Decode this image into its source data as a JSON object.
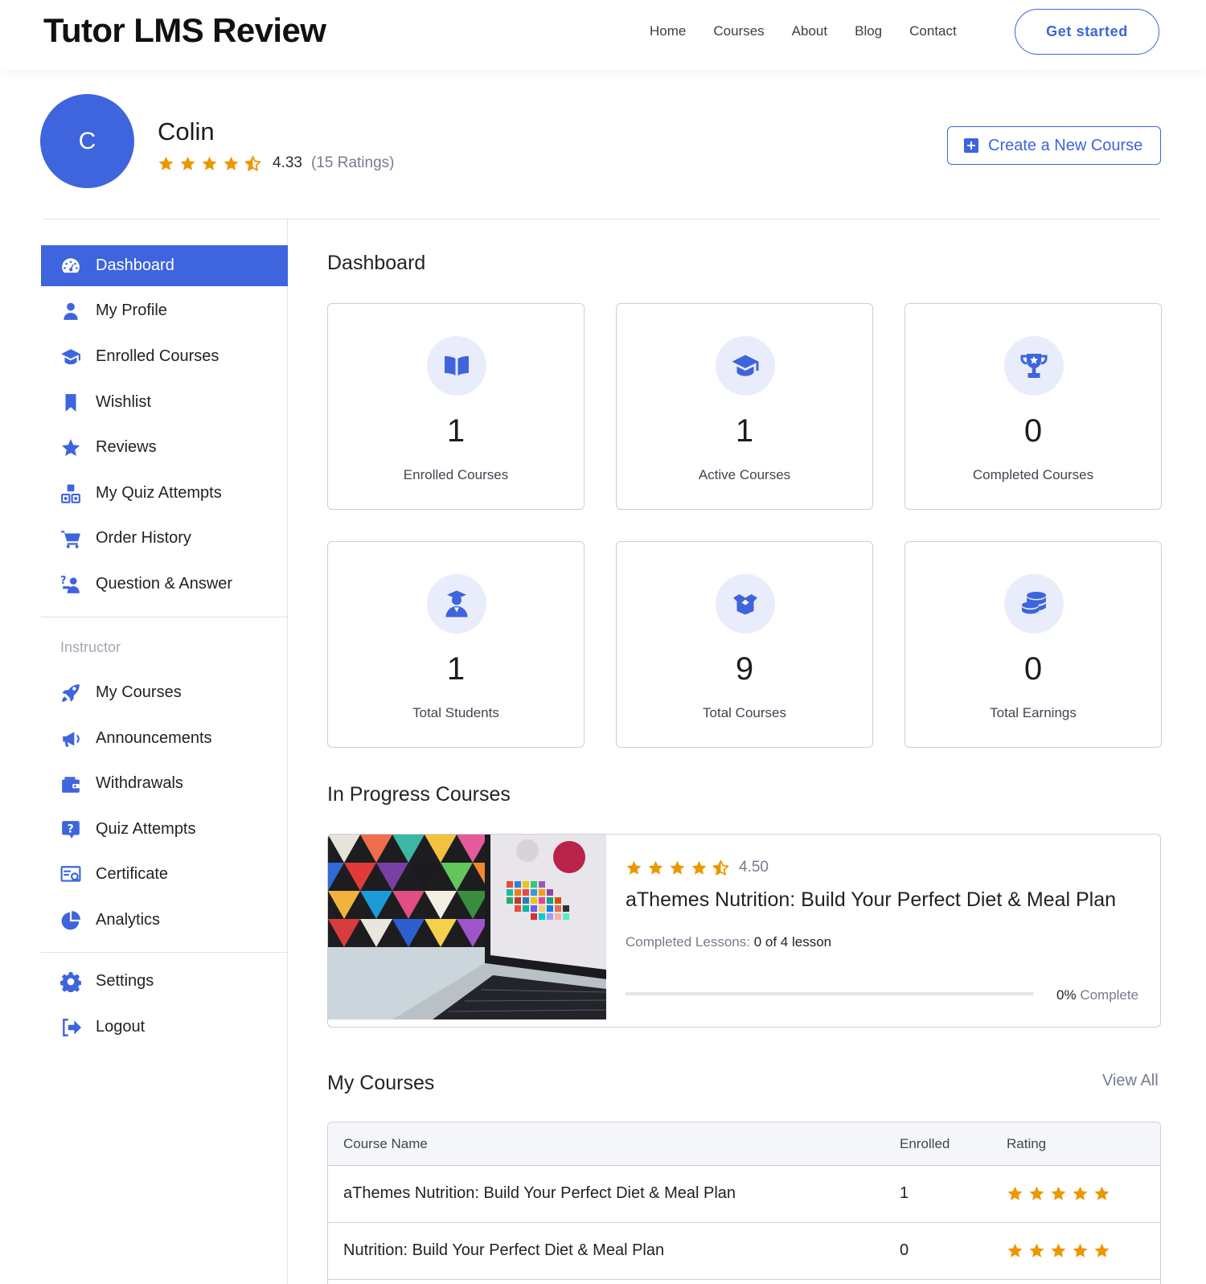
{
  "header": {
    "site_title": "Tutor LMS Review",
    "nav": [
      "Home",
      "Courses",
      "About",
      "Blog",
      "Contact"
    ],
    "cta": "Get started"
  },
  "profile": {
    "avatar_letter": "C",
    "name": "Colin",
    "rating": "4.33",
    "rating_count": "(15 Ratings)",
    "rating_stars": 4.33,
    "create_button": "Create a New Course"
  },
  "sidebar": {
    "items": [
      {
        "label": "Dashboard",
        "icon": "dashboard-icon",
        "active": true
      },
      {
        "label": "My Profile",
        "icon": "user-icon"
      },
      {
        "label": "Enrolled Courses",
        "icon": "graduation-cap-icon"
      },
      {
        "label": "Wishlist",
        "icon": "bookmark-icon"
      },
      {
        "label": "Reviews",
        "icon": "star-icon"
      },
      {
        "label": "My Quiz Attempts",
        "icon": "quiz-blocks-icon"
      },
      {
        "label": "Order History",
        "icon": "cart-icon"
      },
      {
        "label": "Question & Answer",
        "icon": "question-person-icon"
      }
    ],
    "instructor_heading": "Instructor",
    "instructor_items": [
      {
        "label": "My Courses",
        "icon": "rocket-icon"
      },
      {
        "label": "Announcements",
        "icon": "megaphone-icon"
      },
      {
        "label": "Withdrawals",
        "icon": "wallet-icon"
      },
      {
        "label": "Quiz Attempts",
        "icon": "question-box-icon"
      },
      {
        "label": "Certificate",
        "icon": "certificate-icon"
      },
      {
        "label": "Analytics",
        "icon": "pie-chart-icon"
      }
    ],
    "bottom_items": [
      {
        "label": "Settings",
        "icon": "gear-icon"
      },
      {
        "label": "Logout",
        "icon": "logout-icon"
      }
    ]
  },
  "dashboard": {
    "title": "Dashboard",
    "stats": [
      {
        "value": "1",
        "label": "Enrolled Courses",
        "icon": "book-open-icon"
      },
      {
        "value": "1",
        "label": "Active Courses",
        "icon": "graduation-cap-icon"
      },
      {
        "value": "0",
        "label": "Completed Courses",
        "icon": "trophy-icon"
      },
      {
        "value": "1",
        "label": "Total Students",
        "icon": "student-icon"
      },
      {
        "value": "9",
        "label": "Total Courses",
        "icon": "box-icon"
      },
      {
        "value": "0",
        "label": "Total Earnings",
        "icon": "coins-icon"
      }
    ]
  },
  "in_progress": {
    "title": "In Progress Courses",
    "course": {
      "rating": "4.50",
      "rating_stars": 4.5,
      "title": "aThemes Nutrition: Build Your Perfect Diet & Meal Plan",
      "lessons_label": "Completed Lessons:",
      "lessons_value": "0 of 4 lesson",
      "progress_percent": 0,
      "percent_text": "0%",
      "complete_text": "Complete"
    }
  },
  "my_courses": {
    "title": "My Courses",
    "view_all": "View All",
    "columns": [
      "Course Name",
      "Enrolled",
      "Rating"
    ],
    "rows": [
      {
        "name": "aThemes Nutrition: Build Your Perfect Diet & Meal Plan",
        "enrolled": "1",
        "rating": 5
      },
      {
        "name": "Nutrition: Build Your Perfect Diet & Meal Plan",
        "enrolled": "0",
        "rating": 5
      }
    ]
  },
  "colors": {
    "primary": "#3e64de",
    "star": "#ed9700",
    "border": "#cdcfd5",
    "muted": "#757c8e"
  }
}
